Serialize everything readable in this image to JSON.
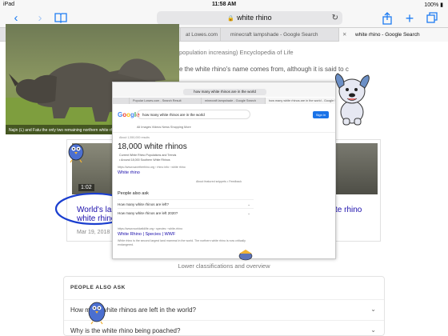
{
  "status_bar": {
    "device": "iPad",
    "time": "11:58 AM",
    "battery": "100%"
  },
  "toolbar": {
    "address": "white rhino"
  },
  "tabs": [
    {
      "label": "at Lowes.com"
    },
    {
      "label": "minecraft lampshade - Google Search"
    },
    {
      "label": "white rhino - Google Search"
    }
  ],
  "background_page": {
    "line1": "population increasing) Encyclopedia of Life",
    "line2": "e the white rhino's name comes from, although it is said to c",
    "result_left_title": "World's las",
    "result_left_sub": "white rhino",
    "result_left_date": "Mar 19, 2018",
    "result_right_title": "te rhino",
    "result_right_sub": "",
    "video_duration": "1:02",
    "lower_classifications": "Lower classifications and overview",
    "paa_heading": "PEOPLE ALSO ASK",
    "paa_questions": [
      "How many white rhinos are left in the world?",
      "Why is the white rhino being poached?"
    ]
  },
  "photo_caption": "Najin (L) and Fatu the only two remaining northern white rhinos",
  "inner": {
    "address": "how many white rhinos are in the world",
    "tabs": [
      "Popular Lowes.com - Search Result",
      "minecraft lampshade - Google Search",
      "how many white rhinos are in the world - Google Search"
    ],
    "logo": "Google",
    "search_query": "how many white rhinos are in the world",
    "sign_in": "Sign in",
    "nav": "All    Images    Videos    News    Shopping    More",
    "stats": "About 1,550,000 results",
    "big_answer": "18,000 white rhinos",
    "answer_sub1": "Current White Rhino Populations and Trends",
    "answer_sub2": "• Around 18,000 Southern White Rhinos",
    "answer_source": "https://www.savetherhino.org › rhino info › white rhino",
    "answer_link": "White rhino",
    "feedback": "About featured snippets • Feedback",
    "paa_heading": "People also ask",
    "paa_rows": [
      "How many white rhinos are left?",
      "How many white rhinos are left 2020?"
    ],
    "result2_source": "https://www.worldwildlife.org › species › white-rhino",
    "result2_link": "White Rhino | Species | WWF",
    "result2_snippet": "White rhino is the second largest land mammal in the world. The northern white rhino is now critically endangered."
  }
}
